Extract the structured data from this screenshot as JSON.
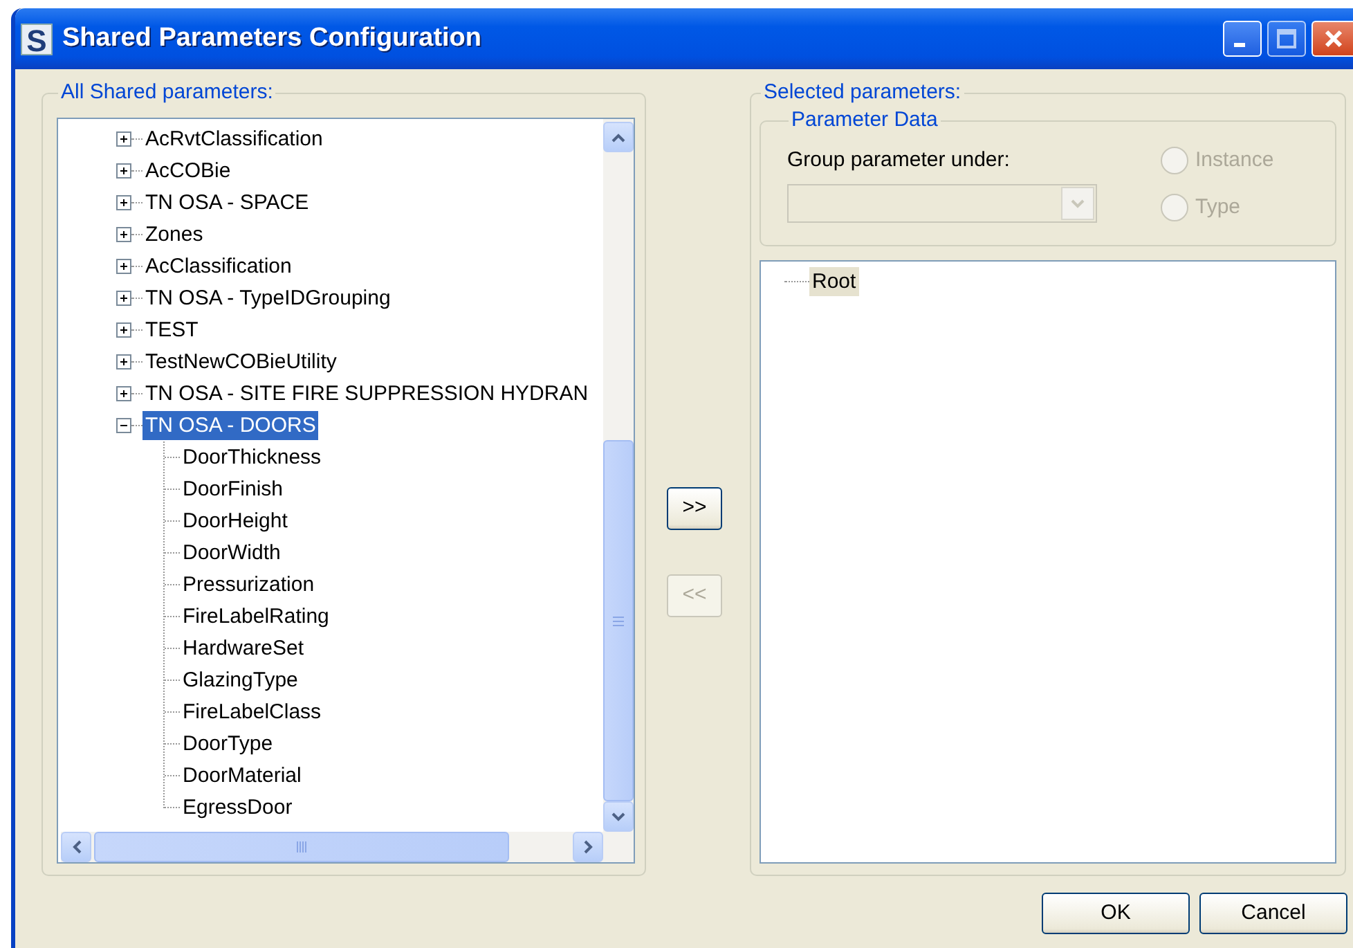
{
  "window": {
    "icon_letter": "S",
    "title": "Shared Parameters Configuration"
  },
  "all_parameters": {
    "label": "All Shared parameters:",
    "tree": [
      {
        "label": "AcRvtClassification",
        "expanded": false,
        "selected": false
      },
      {
        "label": "AcCOBie",
        "expanded": false,
        "selected": false
      },
      {
        "label": "TN OSA - SPACE",
        "expanded": false,
        "selected": false
      },
      {
        "label": "Zones",
        "expanded": false,
        "selected": false
      },
      {
        "label": "AcClassification",
        "expanded": false,
        "selected": false
      },
      {
        "label": "TN OSA - TypeIDGrouping",
        "expanded": false,
        "selected": false
      },
      {
        "label": "TEST",
        "expanded": false,
        "selected": false
      },
      {
        "label": "TestNewCOBieUtility",
        "expanded": false,
        "selected": false
      },
      {
        "label": "TN OSA - SITE FIRE SUPPRESSION HYDRAN",
        "expanded": false,
        "selected": false
      },
      {
        "label": "TN OSA - DOORS",
        "expanded": true,
        "selected": true,
        "children": [
          {
            "label": "DoorThickness"
          },
          {
            "label": "DoorFinish"
          },
          {
            "label": "DoorHeight"
          },
          {
            "label": "DoorWidth"
          },
          {
            "label": "Pressurization"
          },
          {
            "label": "FireLabelRating"
          },
          {
            "label": "HardwareSet"
          },
          {
            "label": "GlazingType"
          },
          {
            "label": "FireLabelClass"
          },
          {
            "label": "DoorType"
          },
          {
            "label": "DoorMaterial"
          },
          {
            "label": "EgressDoor"
          }
        ]
      }
    ]
  },
  "transfer_buttons": [
    {
      "label": ">>",
      "disabled": false
    },
    {
      "label": "<<",
      "disabled": true
    }
  ],
  "selected_parameters": {
    "label": "Selected parameters:",
    "parameter_data": {
      "label": "Parameter Data",
      "group_label": "Group parameter under:",
      "group_select": {
        "disabled": true
      },
      "radios": [
        {
          "label": "Instance",
          "selected": false,
          "disabled": true
        },
        {
          "label": "Type",
          "selected": false,
          "disabled": true
        }
      ]
    },
    "tree": [
      {
        "label": "Root",
        "selected": true
      }
    ]
  },
  "buttons": [
    "OK",
    "Cancel"
  ]
}
